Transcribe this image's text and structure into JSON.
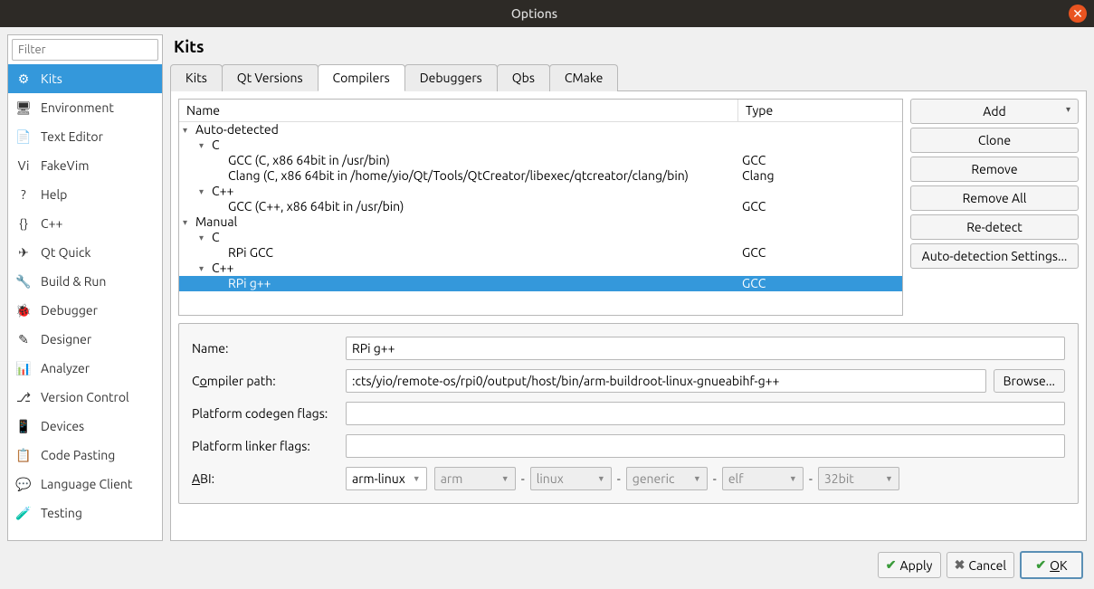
{
  "window": {
    "title": "Options"
  },
  "filter": {
    "placeholder": "Filter"
  },
  "sidebar": {
    "items": [
      {
        "label": "Kits",
        "selected": true
      },
      {
        "label": "Environment"
      },
      {
        "label": "Text Editor"
      },
      {
        "label": "FakeVim"
      },
      {
        "label": "Help"
      },
      {
        "label": "C++"
      },
      {
        "label": "Qt Quick"
      },
      {
        "label": "Build & Run"
      },
      {
        "label": "Debugger"
      },
      {
        "label": "Designer"
      },
      {
        "label": "Analyzer"
      },
      {
        "label": "Version Control"
      },
      {
        "label": "Devices"
      },
      {
        "label": "Code Pasting"
      },
      {
        "label": "Language Client"
      },
      {
        "label": "Testing"
      }
    ]
  },
  "page": {
    "title": "Kits"
  },
  "tabs": [
    {
      "label": "Kits"
    },
    {
      "label": "Qt Versions"
    },
    {
      "label": "Compilers",
      "active": true
    },
    {
      "label": "Debuggers"
    },
    {
      "label": "Qbs"
    },
    {
      "label": "CMake"
    }
  ],
  "tree": {
    "headers": {
      "name": "Name",
      "type": "Type"
    },
    "nodes": [
      {
        "label": "Auto-detected",
        "indent": 0,
        "expanded": true
      },
      {
        "label": "C",
        "indent": 1,
        "expanded": true
      },
      {
        "label": "GCC (C, x86 64bit in /usr/bin)",
        "type": "GCC",
        "indent": 2
      },
      {
        "label": "Clang (C, x86 64bit in /home/yio/Qt/Tools/QtCreator/libexec/qtcreator/clang/bin)",
        "type": "Clang",
        "indent": 2
      },
      {
        "label": "C++",
        "indent": 1,
        "expanded": true
      },
      {
        "label": "GCC (C++, x86 64bit in /usr/bin)",
        "type": "GCC",
        "indent": 2
      },
      {
        "label": "Manual",
        "indent": 0,
        "expanded": true
      },
      {
        "label": "C",
        "indent": 1,
        "expanded": true
      },
      {
        "label": "RPi GCC",
        "type": "GCC",
        "indent": 2
      },
      {
        "label": "C++",
        "indent": 1,
        "expanded": true
      },
      {
        "label": "RPi g++",
        "type": "GCC",
        "indent": 2,
        "selected": true
      }
    ]
  },
  "buttons": {
    "add": "Add",
    "clone": "Clone",
    "remove": "Remove",
    "remove_all": "Remove All",
    "redetect": "Re-detect",
    "autodetect": "Auto-detection Settings..."
  },
  "form": {
    "name_label": "Name:",
    "name_value": "RPi g++",
    "path_label_pre": "C",
    "path_label_ul": "o",
    "path_label_post": "mpiler path:",
    "path_value": ":cts/yio/remote-os/rpi0/output/host/bin/arm-buildroot-linux-gnueabihf-g++",
    "browse": "Browse...",
    "codegen_label": "Platform codegen flags:",
    "codegen_value": "",
    "linker_label": "Platform linker flags:",
    "linker_value": "",
    "abi_label_ul": "A",
    "abi_label_post": "BI:",
    "abi_main": "arm-linux",
    "abi_parts": [
      "arm",
      "linux",
      "generic",
      "elf",
      "32bit"
    ]
  },
  "footer": {
    "apply": "Apply",
    "cancel": "Cancel",
    "ok_ul": "O",
    "ok_post": "K"
  },
  "icons": {
    "sidebar": [
      "⚙",
      "🖥",
      "📄",
      "Vi",
      "?",
      "{}",
      "✈",
      "🔧",
      "🐞",
      "✎",
      "📊",
      "⎇",
      "📱",
      "📋",
      "💬",
      "🧪"
    ]
  }
}
